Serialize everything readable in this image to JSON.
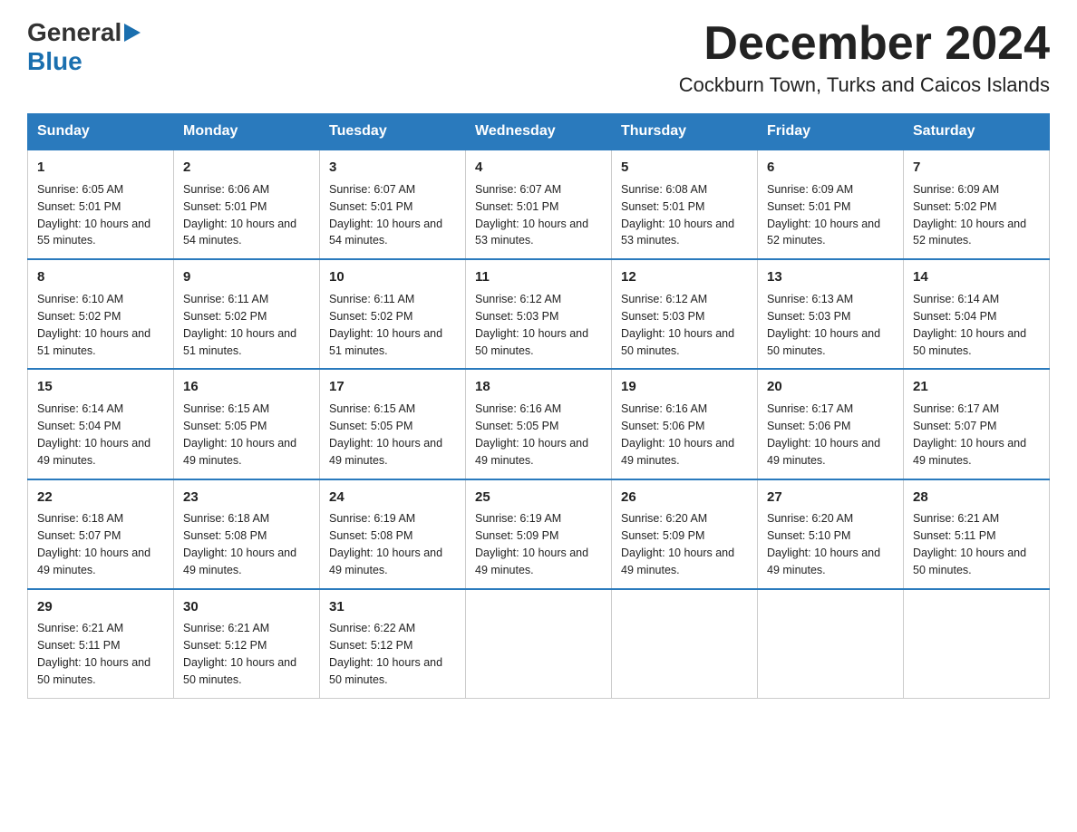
{
  "logo": {
    "general": "General",
    "blue": "Blue",
    "arrow": "▶"
  },
  "title": "December 2024",
  "subtitle": "Cockburn Town, Turks and Caicos Islands",
  "days_of_week": [
    "Sunday",
    "Monday",
    "Tuesday",
    "Wednesday",
    "Thursday",
    "Friday",
    "Saturday"
  ],
  "weeks": [
    [
      {
        "num": "1",
        "sunrise": "6:05 AM",
        "sunset": "5:01 PM",
        "daylight": "10 hours and 55 minutes."
      },
      {
        "num": "2",
        "sunrise": "6:06 AM",
        "sunset": "5:01 PM",
        "daylight": "10 hours and 54 minutes."
      },
      {
        "num": "3",
        "sunrise": "6:07 AM",
        "sunset": "5:01 PM",
        "daylight": "10 hours and 54 minutes."
      },
      {
        "num": "4",
        "sunrise": "6:07 AM",
        "sunset": "5:01 PM",
        "daylight": "10 hours and 53 minutes."
      },
      {
        "num": "5",
        "sunrise": "6:08 AM",
        "sunset": "5:01 PM",
        "daylight": "10 hours and 53 minutes."
      },
      {
        "num": "6",
        "sunrise": "6:09 AM",
        "sunset": "5:01 PM",
        "daylight": "10 hours and 52 minutes."
      },
      {
        "num": "7",
        "sunrise": "6:09 AM",
        "sunset": "5:02 PM",
        "daylight": "10 hours and 52 minutes."
      }
    ],
    [
      {
        "num": "8",
        "sunrise": "6:10 AM",
        "sunset": "5:02 PM",
        "daylight": "10 hours and 51 minutes."
      },
      {
        "num": "9",
        "sunrise": "6:11 AM",
        "sunset": "5:02 PM",
        "daylight": "10 hours and 51 minutes."
      },
      {
        "num": "10",
        "sunrise": "6:11 AM",
        "sunset": "5:02 PM",
        "daylight": "10 hours and 51 minutes."
      },
      {
        "num": "11",
        "sunrise": "6:12 AM",
        "sunset": "5:03 PM",
        "daylight": "10 hours and 50 minutes."
      },
      {
        "num": "12",
        "sunrise": "6:12 AM",
        "sunset": "5:03 PM",
        "daylight": "10 hours and 50 minutes."
      },
      {
        "num": "13",
        "sunrise": "6:13 AM",
        "sunset": "5:03 PM",
        "daylight": "10 hours and 50 minutes."
      },
      {
        "num": "14",
        "sunrise": "6:14 AM",
        "sunset": "5:04 PM",
        "daylight": "10 hours and 50 minutes."
      }
    ],
    [
      {
        "num": "15",
        "sunrise": "6:14 AM",
        "sunset": "5:04 PM",
        "daylight": "10 hours and 49 minutes."
      },
      {
        "num": "16",
        "sunrise": "6:15 AM",
        "sunset": "5:05 PM",
        "daylight": "10 hours and 49 minutes."
      },
      {
        "num": "17",
        "sunrise": "6:15 AM",
        "sunset": "5:05 PM",
        "daylight": "10 hours and 49 minutes."
      },
      {
        "num": "18",
        "sunrise": "6:16 AM",
        "sunset": "5:05 PM",
        "daylight": "10 hours and 49 minutes."
      },
      {
        "num": "19",
        "sunrise": "6:16 AM",
        "sunset": "5:06 PM",
        "daylight": "10 hours and 49 minutes."
      },
      {
        "num": "20",
        "sunrise": "6:17 AM",
        "sunset": "5:06 PM",
        "daylight": "10 hours and 49 minutes."
      },
      {
        "num": "21",
        "sunrise": "6:17 AM",
        "sunset": "5:07 PM",
        "daylight": "10 hours and 49 minutes."
      }
    ],
    [
      {
        "num": "22",
        "sunrise": "6:18 AM",
        "sunset": "5:07 PM",
        "daylight": "10 hours and 49 minutes."
      },
      {
        "num": "23",
        "sunrise": "6:18 AM",
        "sunset": "5:08 PM",
        "daylight": "10 hours and 49 minutes."
      },
      {
        "num": "24",
        "sunrise": "6:19 AM",
        "sunset": "5:08 PM",
        "daylight": "10 hours and 49 minutes."
      },
      {
        "num": "25",
        "sunrise": "6:19 AM",
        "sunset": "5:09 PM",
        "daylight": "10 hours and 49 minutes."
      },
      {
        "num": "26",
        "sunrise": "6:20 AM",
        "sunset": "5:09 PM",
        "daylight": "10 hours and 49 minutes."
      },
      {
        "num": "27",
        "sunrise": "6:20 AM",
        "sunset": "5:10 PM",
        "daylight": "10 hours and 49 minutes."
      },
      {
        "num": "28",
        "sunrise": "6:21 AM",
        "sunset": "5:11 PM",
        "daylight": "10 hours and 50 minutes."
      }
    ],
    [
      {
        "num": "29",
        "sunrise": "6:21 AM",
        "sunset": "5:11 PM",
        "daylight": "10 hours and 50 minutes."
      },
      {
        "num": "30",
        "sunrise": "6:21 AM",
        "sunset": "5:12 PM",
        "daylight": "10 hours and 50 minutes."
      },
      {
        "num": "31",
        "sunrise": "6:22 AM",
        "sunset": "5:12 PM",
        "daylight": "10 hours and 50 minutes."
      },
      null,
      null,
      null,
      null
    ]
  ]
}
